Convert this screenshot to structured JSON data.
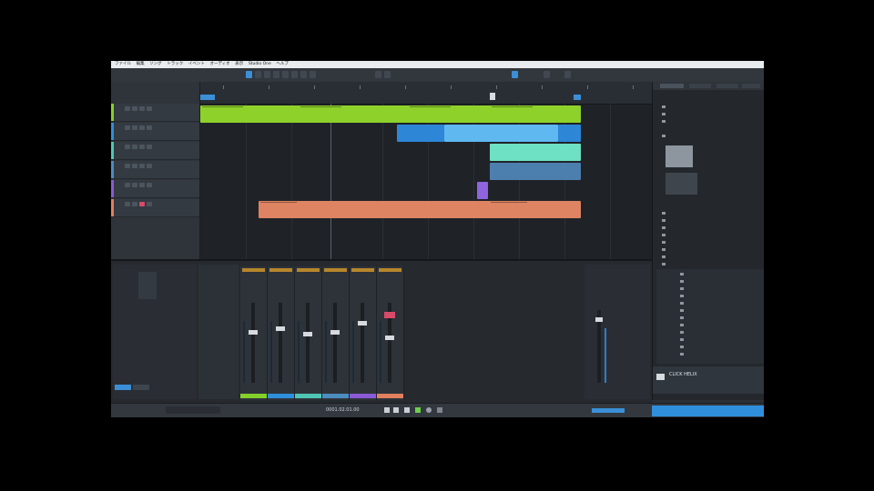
{
  "menubar": {
    "items": [
      "ファイル",
      "編集",
      "ソング",
      "トラック",
      "イベント",
      "オーディオ",
      "表示",
      "Studio One",
      "ヘルプ"
    ]
  },
  "tracks": [
    {
      "name": "",
      "number": "",
      "color": "#84d12a"
    },
    {
      "name": "",
      "number": "",
      "color": "#2f8fdc"
    },
    {
      "name": "",
      "number": "",
      "color": "#4fc7b6"
    },
    {
      "name": "",
      "number": "",
      "color": "#4c8dbf"
    },
    {
      "name": "",
      "number": "",
      "color": "#8a5ad8"
    },
    {
      "name": "",
      "number": "",
      "color": "#e0805e"
    }
  ],
  "colors": {
    "green": "#8ed12a",
    "blue": "#2e86d6",
    "light_blue": "#5fb8f0",
    "teal": "#6ee0c4",
    "steel": "#4d7fae",
    "purple": "#8f64dc",
    "salmon": "#de8463"
  },
  "mixer": {
    "strip_colors": [
      "#84d12a",
      "#2f8fdc",
      "#4fc7b6",
      "#4c8dbf",
      "#8a5ad8",
      "#e0805e"
    ]
  },
  "browser": {
    "footer_title": "CLICK HELIX"
  },
  "transport": {
    "time": "0001.02.01.00"
  }
}
